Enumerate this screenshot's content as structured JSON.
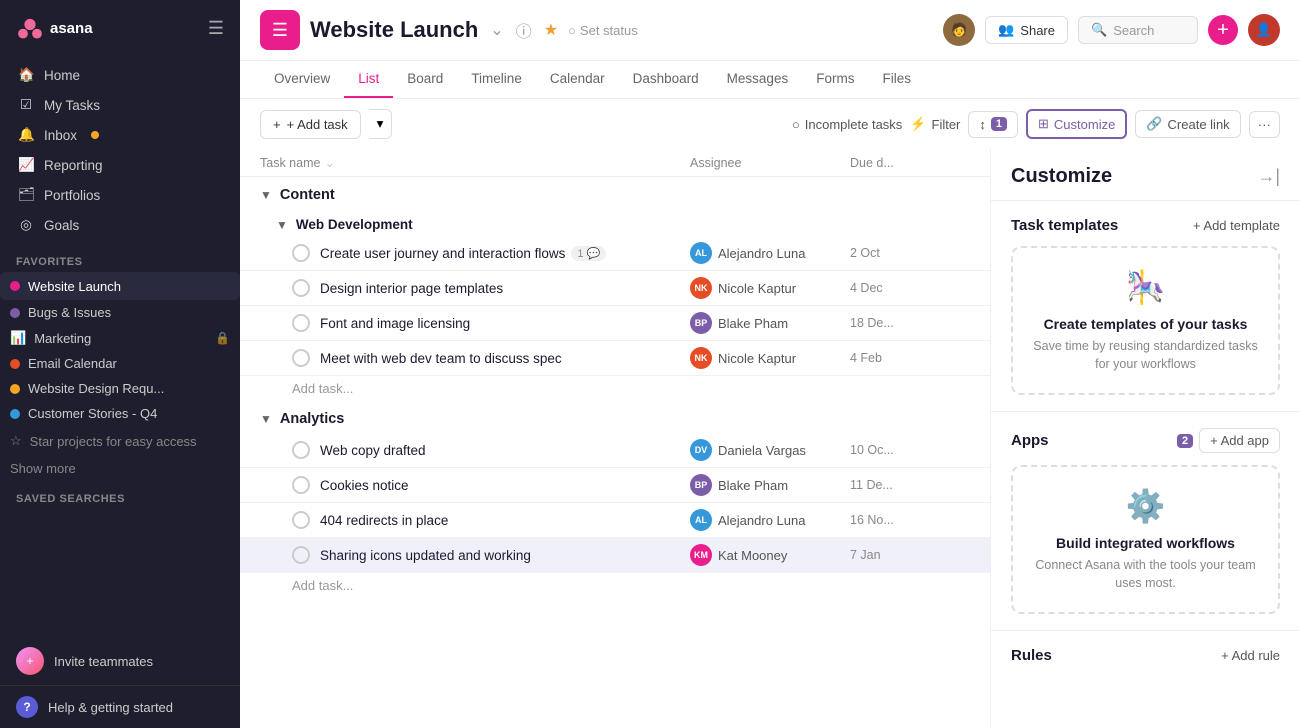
{
  "sidebar": {
    "logo": "asana",
    "nav_items": [
      {
        "id": "home",
        "label": "Home",
        "icon": "🏠"
      },
      {
        "id": "my-tasks",
        "label": "My Tasks",
        "icon": "✓"
      },
      {
        "id": "inbox",
        "label": "Inbox",
        "icon": "🔔",
        "badge": true
      },
      {
        "id": "reporting",
        "label": "Reporting",
        "icon": "📈"
      },
      {
        "id": "portfolios",
        "label": "Portfolios",
        "icon": "🗂"
      },
      {
        "id": "goals",
        "label": "Goals",
        "icon": "👤"
      }
    ],
    "favorites_label": "Favorites",
    "favorites": [
      {
        "id": "website-launch",
        "label": "Website Launch",
        "color": "#e91e8c",
        "active": true
      },
      {
        "id": "bugs-issues",
        "label": "Bugs & Issues",
        "color": "#7b5ea7"
      },
      {
        "id": "marketing",
        "label": "Marketing",
        "color": "#f5a623",
        "lock": true
      },
      {
        "id": "email-calendar",
        "label": "Email Calendar",
        "color": "#e44d26"
      },
      {
        "id": "website-design",
        "label": "Website Design Requ...",
        "color": "#f5a623"
      },
      {
        "id": "customer-stories",
        "label": "Customer Stories - Q4",
        "color": "#3498db"
      }
    ],
    "star_projects_label": "Star projects for easy access",
    "show_more_label": "Show more",
    "saved_searches_label": "Saved searches",
    "invite_teammates_label": "Invite teammates",
    "help_label": "Help & getting started"
  },
  "header": {
    "project_title": "Website Launch",
    "set_status_label": "Set status",
    "share_label": "Share",
    "search_placeholder": "Search"
  },
  "tabs": [
    {
      "id": "overview",
      "label": "Overview"
    },
    {
      "id": "list",
      "label": "List",
      "active": true
    },
    {
      "id": "board",
      "label": "Board"
    },
    {
      "id": "timeline",
      "label": "Timeline"
    },
    {
      "id": "calendar",
      "label": "Calendar"
    },
    {
      "id": "dashboard",
      "label": "Dashboard"
    },
    {
      "id": "messages",
      "label": "Messages"
    },
    {
      "id": "forms",
      "label": "Forms"
    },
    {
      "id": "files",
      "label": "Files"
    }
  ],
  "toolbar": {
    "add_task_label": "+ Add task",
    "incomplete_tasks_label": "Incomplete tasks",
    "filter_label": "Filter",
    "sort_badge": "1",
    "customize_label": "Customize",
    "create_link_label": "Create link"
  },
  "columns": {
    "task_name": "Task name",
    "assignee": "Assignee",
    "due_date": "Due d..."
  },
  "sections": [
    {
      "id": "content",
      "label": "Content",
      "subsections": [
        {
          "id": "web-development",
          "label": "Web Development",
          "tasks": [
            {
              "id": "t1",
              "name": "Create user journey and interaction flows",
              "comment_count": "1 💬",
              "assignee": "Alejandro Luna",
              "due": "2 Oct",
              "avatar_color": "#3498db",
              "avatar_initials": "AL"
            },
            {
              "id": "t2",
              "name": "Design interior page templates",
              "assignee": "Nicole Kaptur",
              "due": "4 Dec",
              "avatar_color": "#e44d26",
              "avatar_initials": "NK"
            },
            {
              "id": "t3",
              "name": "Font and image licensing",
              "assignee": "Blake Pham",
              "due": "18 De...",
              "avatar_color": "#7b5ea7",
              "avatar_initials": "BP"
            },
            {
              "id": "t4",
              "name": "Meet with web dev team to discuss spec",
              "assignee": "Nicole Kaptur",
              "due": "4 Feb",
              "avatar_color": "#e44d26",
              "avatar_initials": "NK"
            }
          ]
        }
      ]
    },
    {
      "id": "analytics",
      "label": "Analytics",
      "tasks": [
        {
          "id": "t5",
          "name": "Web copy drafted",
          "assignee": "Daniela Vargas",
          "due": "10 Oc...",
          "avatar_color": "#3498db",
          "avatar_initials": "DV"
        },
        {
          "id": "t6",
          "name": "Cookies notice",
          "assignee": "Blake Pham",
          "due": "11 De...",
          "avatar_color": "#7b5ea7",
          "avatar_initials": "BP"
        },
        {
          "id": "t7",
          "name": "404 redirects in place",
          "assignee": "Alejandro Luna",
          "due": "16 No...",
          "avatar_color": "#3498db",
          "avatar_initials": "AL"
        },
        {
          "id": "t8",
          "name": "Sharing icons updated and working",
          "assignee": "Kat Mooney",
          "due": "7 Jan",
          "avatar_color": "#e91e8c",
          "avatar_initials": "KM",
          "highlighted": true
        }
      ]
    }
  ],
  "customize_panel": {
    "title": "Customize",
    "close_icon": "→|",
    "task_templates": {
      "title": "Task templates",
      "add_label": "+ Add template",
      "card_title": "Create templates of your tasks",
      "card_desc": "Save time by reusing standardized tasks for your workflows"
    },
    "apps": {
      "title": "Apps",
      "badge": "2",
      "add_label": "+ Add app",
      "card_title": "Build integrated workflows",
      "card_desc": "Connect Asana with the tools your team uses most."
    },
    "rules": {
      "title": "Rules",
      "add_label": "+ Add rule"
    }
  }
}
